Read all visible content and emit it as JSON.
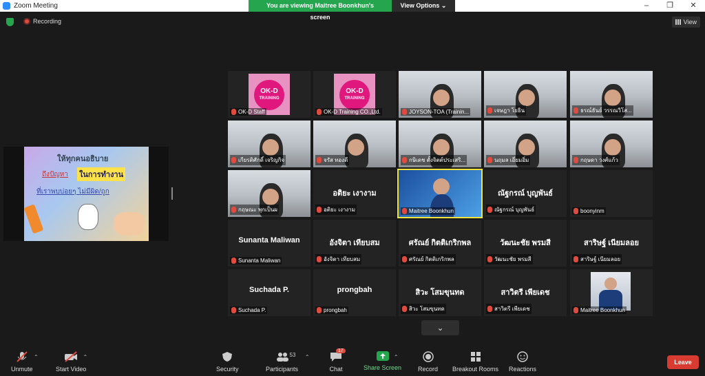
{
  "window": {
    "title": "Zoom Meeting",
    "controls": [
      "–",
      "❐",
      "✕"
    ]
  },
  "banner": {
    "text": "You are viewing Maitree Boonkhun's screen",
    "options": "View Options ⌄"
  },
  "topbar": {
    "recording": "Recording",
    "view": "View"
  },
  "slide": {
    "line1": "ให้ทุกคนอธิบาย",
    "line2": "ถึงปัญหา",
    "highlight": "ในการทำงาน",
    "line3": "ที่เราพบบ่อยๆ ไม่มีผิด/ถูก"
  },
  "tiles": [
    {
      "name": "OK-D Staff",
      "type": "logo"
    },
    {
      "name": "OK-D Training CO.,Ltd.",
      "type": "logo"
    },
    {
      "name": "JOYSON-TOA (Trainin...",
      "type": "video"
    },
    {
      "name": "เจษฎา  โยธิน",
      "type": "video"
    },
    {
      "name": "ธรณ์ธันย์ วรรณวิโส...",
      "type": "video"
    },
    {
      "name": "เกียรติศักดิ์ เจริญกิจ",
      "type": "video"
    },
    {
      "name": "จรัส ทองดี",
      "type": "video"
    },
    {
      "name": "กษิเดช ตั้งจิตต์ประเสริ...",
      "type": "video"
    },
    {
      "name": "นฤมล เอี่ยมอิ่ม",
      "type": "video"
    },
    {
      "name": "กฤษดา วงศ์แก้ว",
      "type": "video"
    },
    {
      "name": "กฤษณะ พุกเป็นผ",
      "type": "video"
    },
    {
      "name": "อติยะ เงางาม",
      "type": "name",
      "big": "อติยะ เงางาม"
    },
    {
      "name": "Maitree Boonkhun",
      "type": "video-active"
    },
    {
      "name": "ณัฐกรณ์ บุญพันธ์",
      "type": "name",
      "big": "ณัฐกรณ์ บุญพันธ์"
    },
    {
      "name": "boonyinm",
      "type": "dark"
    },
    {
      "name": "Sunanta Maliwan",
      "type": "name",
      "big": "Sunanta Maliwan"
    },
    {
      "name": "อังจิตา เทียบสม",
      "type": "name",
      "big": "อังจิตา เทียบสม"
    },
    {
      "name": "ศรัณย์ กิตติเกริกพล",
      "type": "name",
      "big": "ศรัณย์ กิตติเกริกพล"
    },
    {
      "name": "วัฒนะชัย พรมสี",
      "type": "name",
      "big": "วัฒนะชัย พรมสี"
    },
    {
      "name": "สาริษฐ์ เนียมลอย",
      "type": "name",
      "big": "สาริษฐ์ เนียมลอย"
    },
    {
      "name": "Suchada P.",
      "type": "name",
      "big": "Suchada P."
    },
    {
      "name": "prongbah",
      "type": "name",
      "big": "prongbah"
    },
    {
      "name": "สิวะ  โสมขุนทด",
      "type": "name",
      "big": "สิวะ  โสมขุนทด"
    },
    {
      "name": "สาวิตรี เพียเดช",
      "type": "name",
      "big": "สาวิตรี เพียเดช"
    },
    {
      "name": "Maitree Boonkhun",
      "type": "portrait"
    }
  ],
  "toolbar": {
    "unmute": "Unmute",
    "start_video": "Start Video",
    "security": "Security",
    "participants": "Participants",
    "participant_count": "53",
    "chat": "Chat",
    "chat_badge": "17",
    "share_screen": "Share Screen",
    "record": "Record",
    "breakout": "Breakout Rooms",
    "reactions": "Reactions",
    "leave": "Leave"
  }
}
